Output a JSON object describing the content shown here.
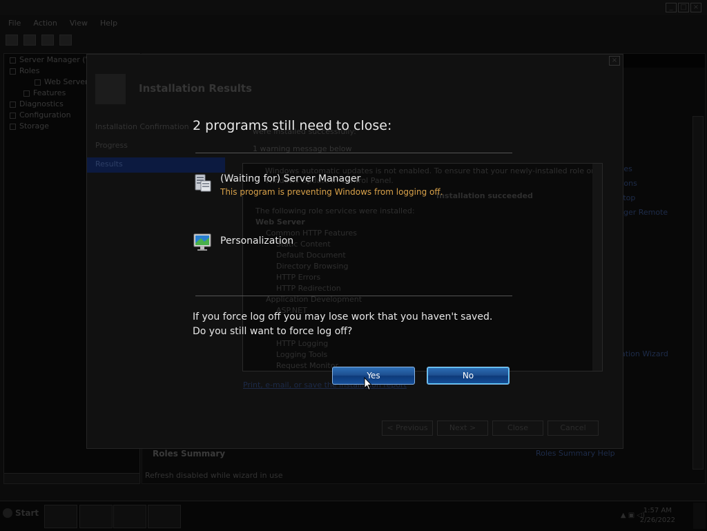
{
  "menu": [
    "File",
    "Action",
    "View",
    "Help"
  ],
  "tree": {
    "root": "Server Manager (W",
    "roles": "Roles",
    "web_server": "Web Server",
    "features": "Features",
    "diagnostics": "Diagnostics",
    "configuration": "Configuration",
    "storage": "Storage"
  },
  "wizard": {
    "title": "Installation Results",
    "steps": [
      "Installation Confirmation",
      "Progress",
      "Results"
    ],
    "summary": "were installed successfully:",
    "warning": "1 warning message below",
    "results_lines": [
      "Windows automatic updates is not enabled. To ensure that your newly-installed role or feature is",
      "Windows Update in Control Panel.",
      "Installation succeeded",
      "The following role services were installed:",
      "Web Server",
      "Common HTTP Features",
      "Static Content",
      "Default Document",
      "Directory Browsing",
      "HTTP Errors",
      "HTTP Redirection",
      "Application Development",
      "ASP.NET",
      "HTTP Logging",
      "Logging Tools",
      "Request Monitor"
    ],
    "print_link": "Print, e-mail, or save the installation report",
    "buttons": [
      "< Previous",
      "Next >",
      "Close",
      "Cancel"
    ]
  },
  "right_pane": {
    "links": [
      "ties",
      "tions",
      "ktop",
      "nger Remote"
    ],
    "wizard_link": "lation Wizard",
    "roles_summary": "Roles Summary",
    "roles_summary_help": "Roles Summary Help",
    "refresh_note": "Refresh disabled while wizard in use"
  },
  "taskbar": {
    "start": "Start",
    "time": "1:57 AM",
    "date": "2/26/2022"
  },
  "dialog": {
    "heading": "2 programs still need to close:",
    "programs": [
      {
        "name": "(Waiting for) Server Manager",
        "detail": "This program is preventing Windows from logging off.",
        "icon": "server-manager-icon"
      },
      {
        "name": "Personalization",
        "detail": "",
        "icon": "personalization-icon"
      }
    ],
    "warning_line1": "If you force log off you may lose work that you haven't saved.",
    "warning_line2": "Do you still want to force log off?",
    "yes_label": "Yes",
    "no_label": "No",
    "colors": {
      "detail_text": "#d9a24a",
      "button": "#1d4e8f"
    }
  }
}
